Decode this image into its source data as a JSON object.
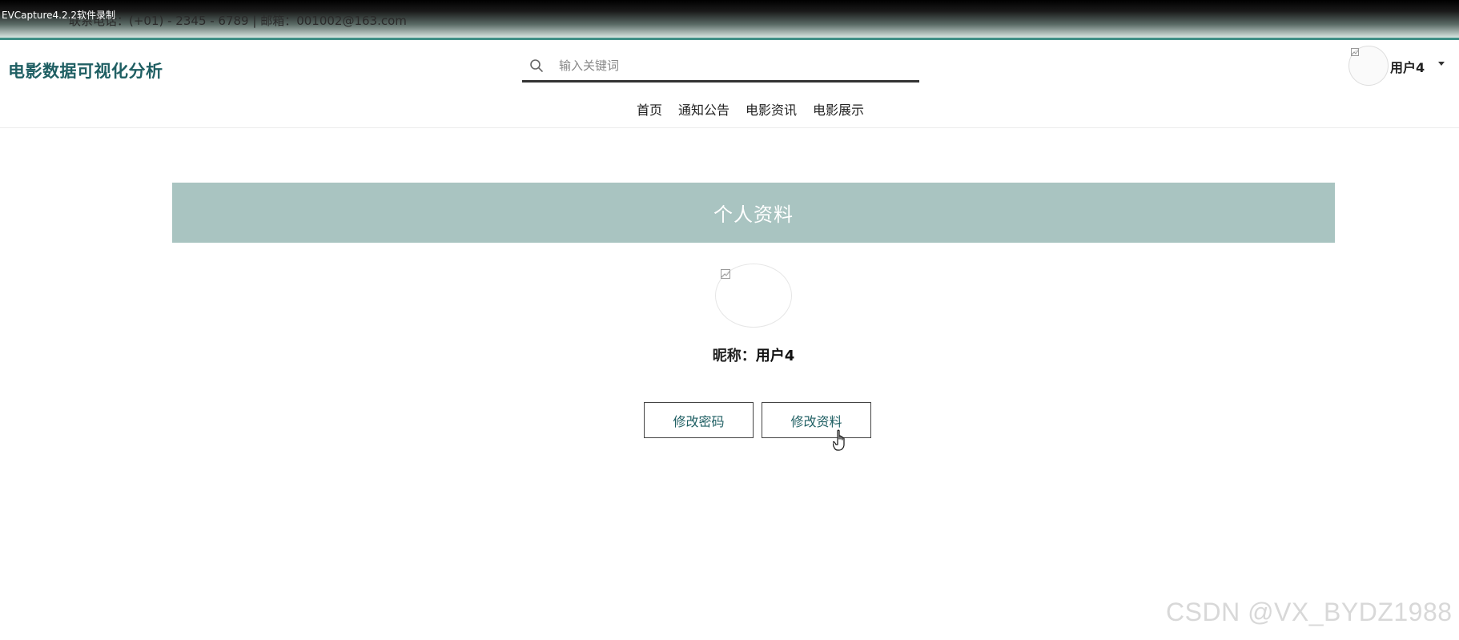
{
  "topbar": {
    "recorder_label": "EVCapture4.2.2软件录制",
    "contact_text": "联系电话：(+01) - 2345 - 6789 | 邮箱：001002@163.com"
  },
  "header": {
    "site_title": "电影数据可视化分析",
    "search": {
      "placeholder": "输入关键词",
      "value": "",
      "icon": "search-icon"
    },
    "user": {
      "name": "用户4",
      "avatar_icon": "broken-image-icon",
      "dropdown_icon": "caret-down-icon"
    },
    "nav": [
      {
        "label": "首页"
      },
      {
        "label": "通知公告"
      },
      {
        "label": "电影资讯"
      },
      {
        "label": "电影展示"
      }
    ]
  },
  "profile": {
    "panel_title": "个人资料",
    "avatar_icon": "broken-image-icon",
    "nickname_label": "昵称：",
    "nickname_value": "用户4",
    "buttons": {
      "change_password": "修改密码",
      "edit_profile": "修改资料"
    }
  },
  "watermark": "CSDN @VX_BYDZ1988",
  "colors": {
    "brand": "#1f5f63",
    "panel_header_bg": "#a9c4c1",
    "topbar_accent": "#3f8f86"
  }
}
